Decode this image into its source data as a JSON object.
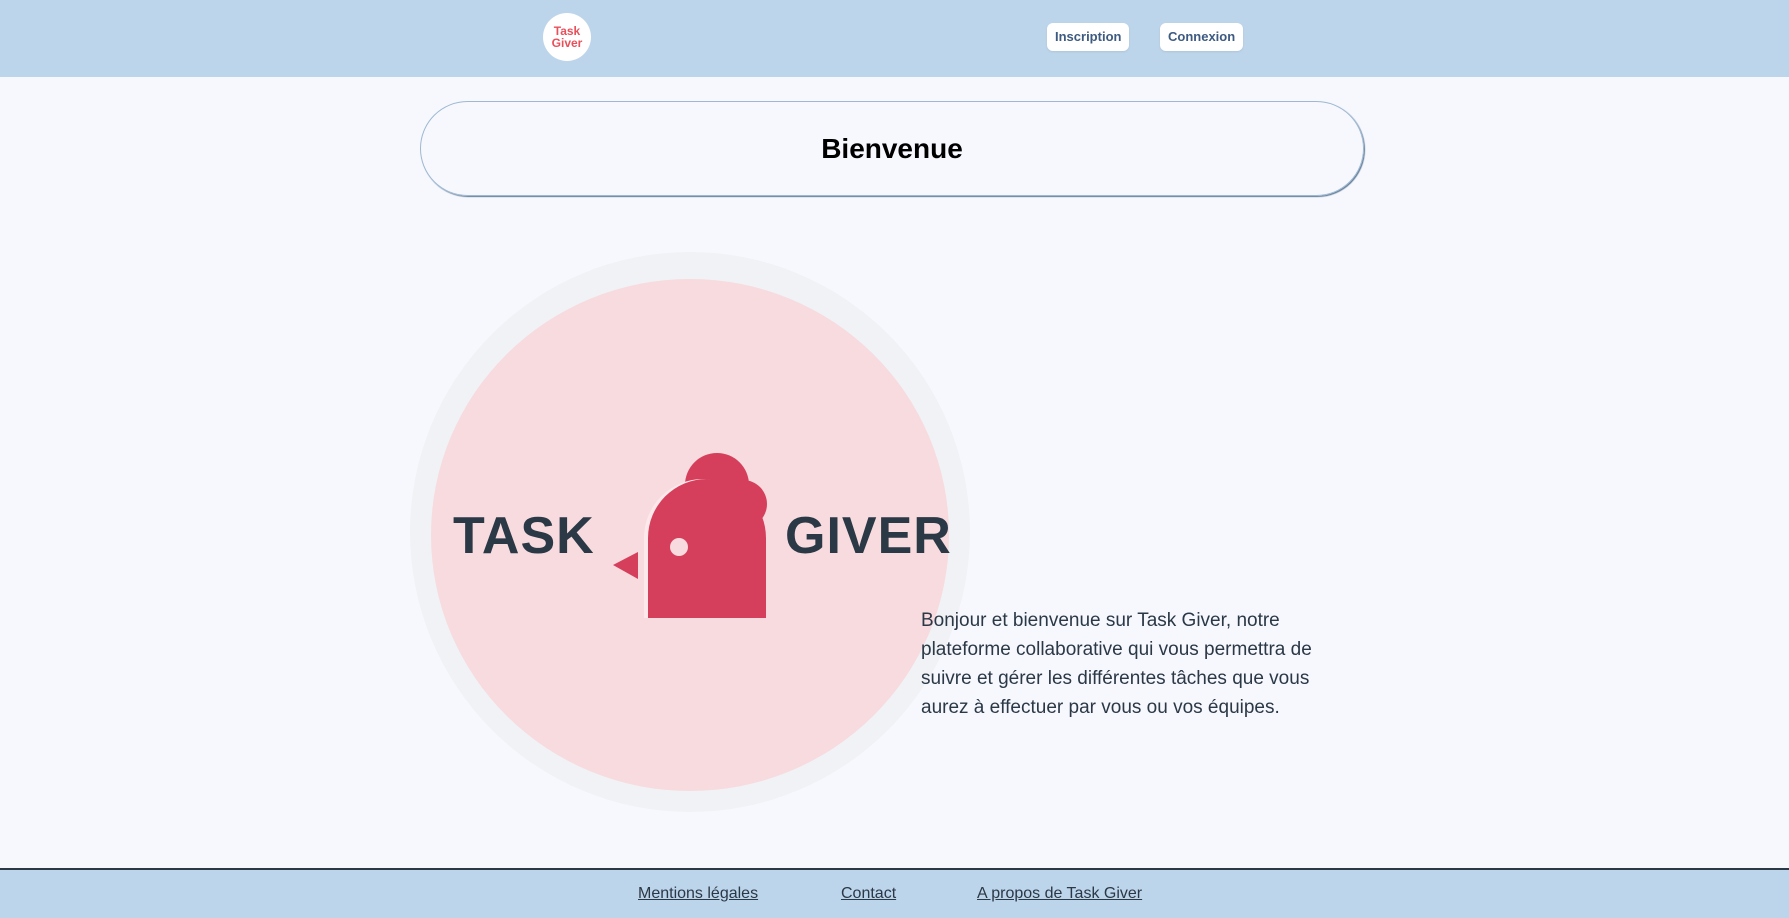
{
  "header": {
    "logo_line1": "Task",
    "logo_line2": "Giver",
    "signup_label": "Inscription",
    "login_label": "Connexion"
  },
  "main": {
    "title": "Bienvenue",
    "logo_word_left": "TASK",
    "logo_word_right": "GIVER",
    "intro": "Bonjour et bienvenue sur Task Giver, notre plateforme collaborative qui vous permettra de suivre et gérer les différentes tâches que vous aurez à effectuer par vous ou vos équipes."
  },
  "footer": {
    "links": [
      {
        "label": "Mentions légales"
      },
      {
        "label": "Contact"
      },
      {
        "label": "A propos de Task Giver"
      }
    ]
  },
  "colors": {
    "header_bg": "#bdd5ea",
    "page_bg": "#f7f8fe",
    "brand_red": "#d63f5b",
    "logo_bg_pink": "#f7dbde",
    "text_dark": "#2b3846"
  },
  "icons": {
    "brand": "rooster-icon"
  }
}
